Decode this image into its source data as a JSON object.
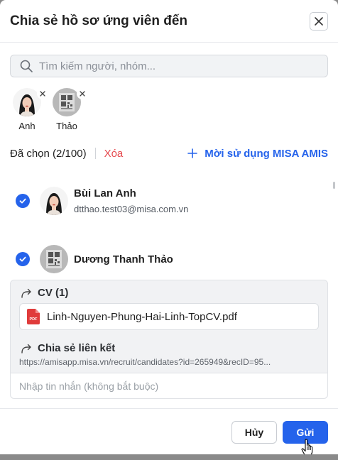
{
  "dialog": {
    "title": "Chia sẻ hồ sơ ứng viên đến"
  },
  "search": {
    "placeholder": "Tìm kiếm người, nhóm..."
  },
  "chips": [
    {
      "label": "Anh"
    },
    {
      "label": "Thảo"
    }
  ],
  "selection": {
    "count_label": "Đã chọn (2/100)",
    "clear_label": "Xóa",
    "invite_label": "Mời sử dụng MISA AMIS"
  },
  "people": [
    {
      "name": "Bùi Lan Anh",
      "email": "dtthao.test03@misa.com.vn"
    },
    {
      "name": "Dương Thanh Thảo",
      "email": ""
    }
  ],
  "attachments": {
    "cv_label": "CV (1)",
    "file_name": "Linh-Nguyen-Phung-Hai-Linh-TopCV.pdf",
    "file_type": "PDF",
    "share_link_label": "Chia sẻ liên kết",
    "share_link_url": "https://amisapp.misa.vn/recruit/candidates?id=265949&recID=95..."
  },
  "message": {
    "placeholder": "Nhập tin nhắn (không bắt buộc)"
  },
  "footer": {
    "cancel_label": "Hủy",
    "send_label": "Gửi"
  },
  "colors": {
    "primary": "#2563eb",
    "danger": "#e5484d",
    "panel": "#f1f2f4"
  }
}
